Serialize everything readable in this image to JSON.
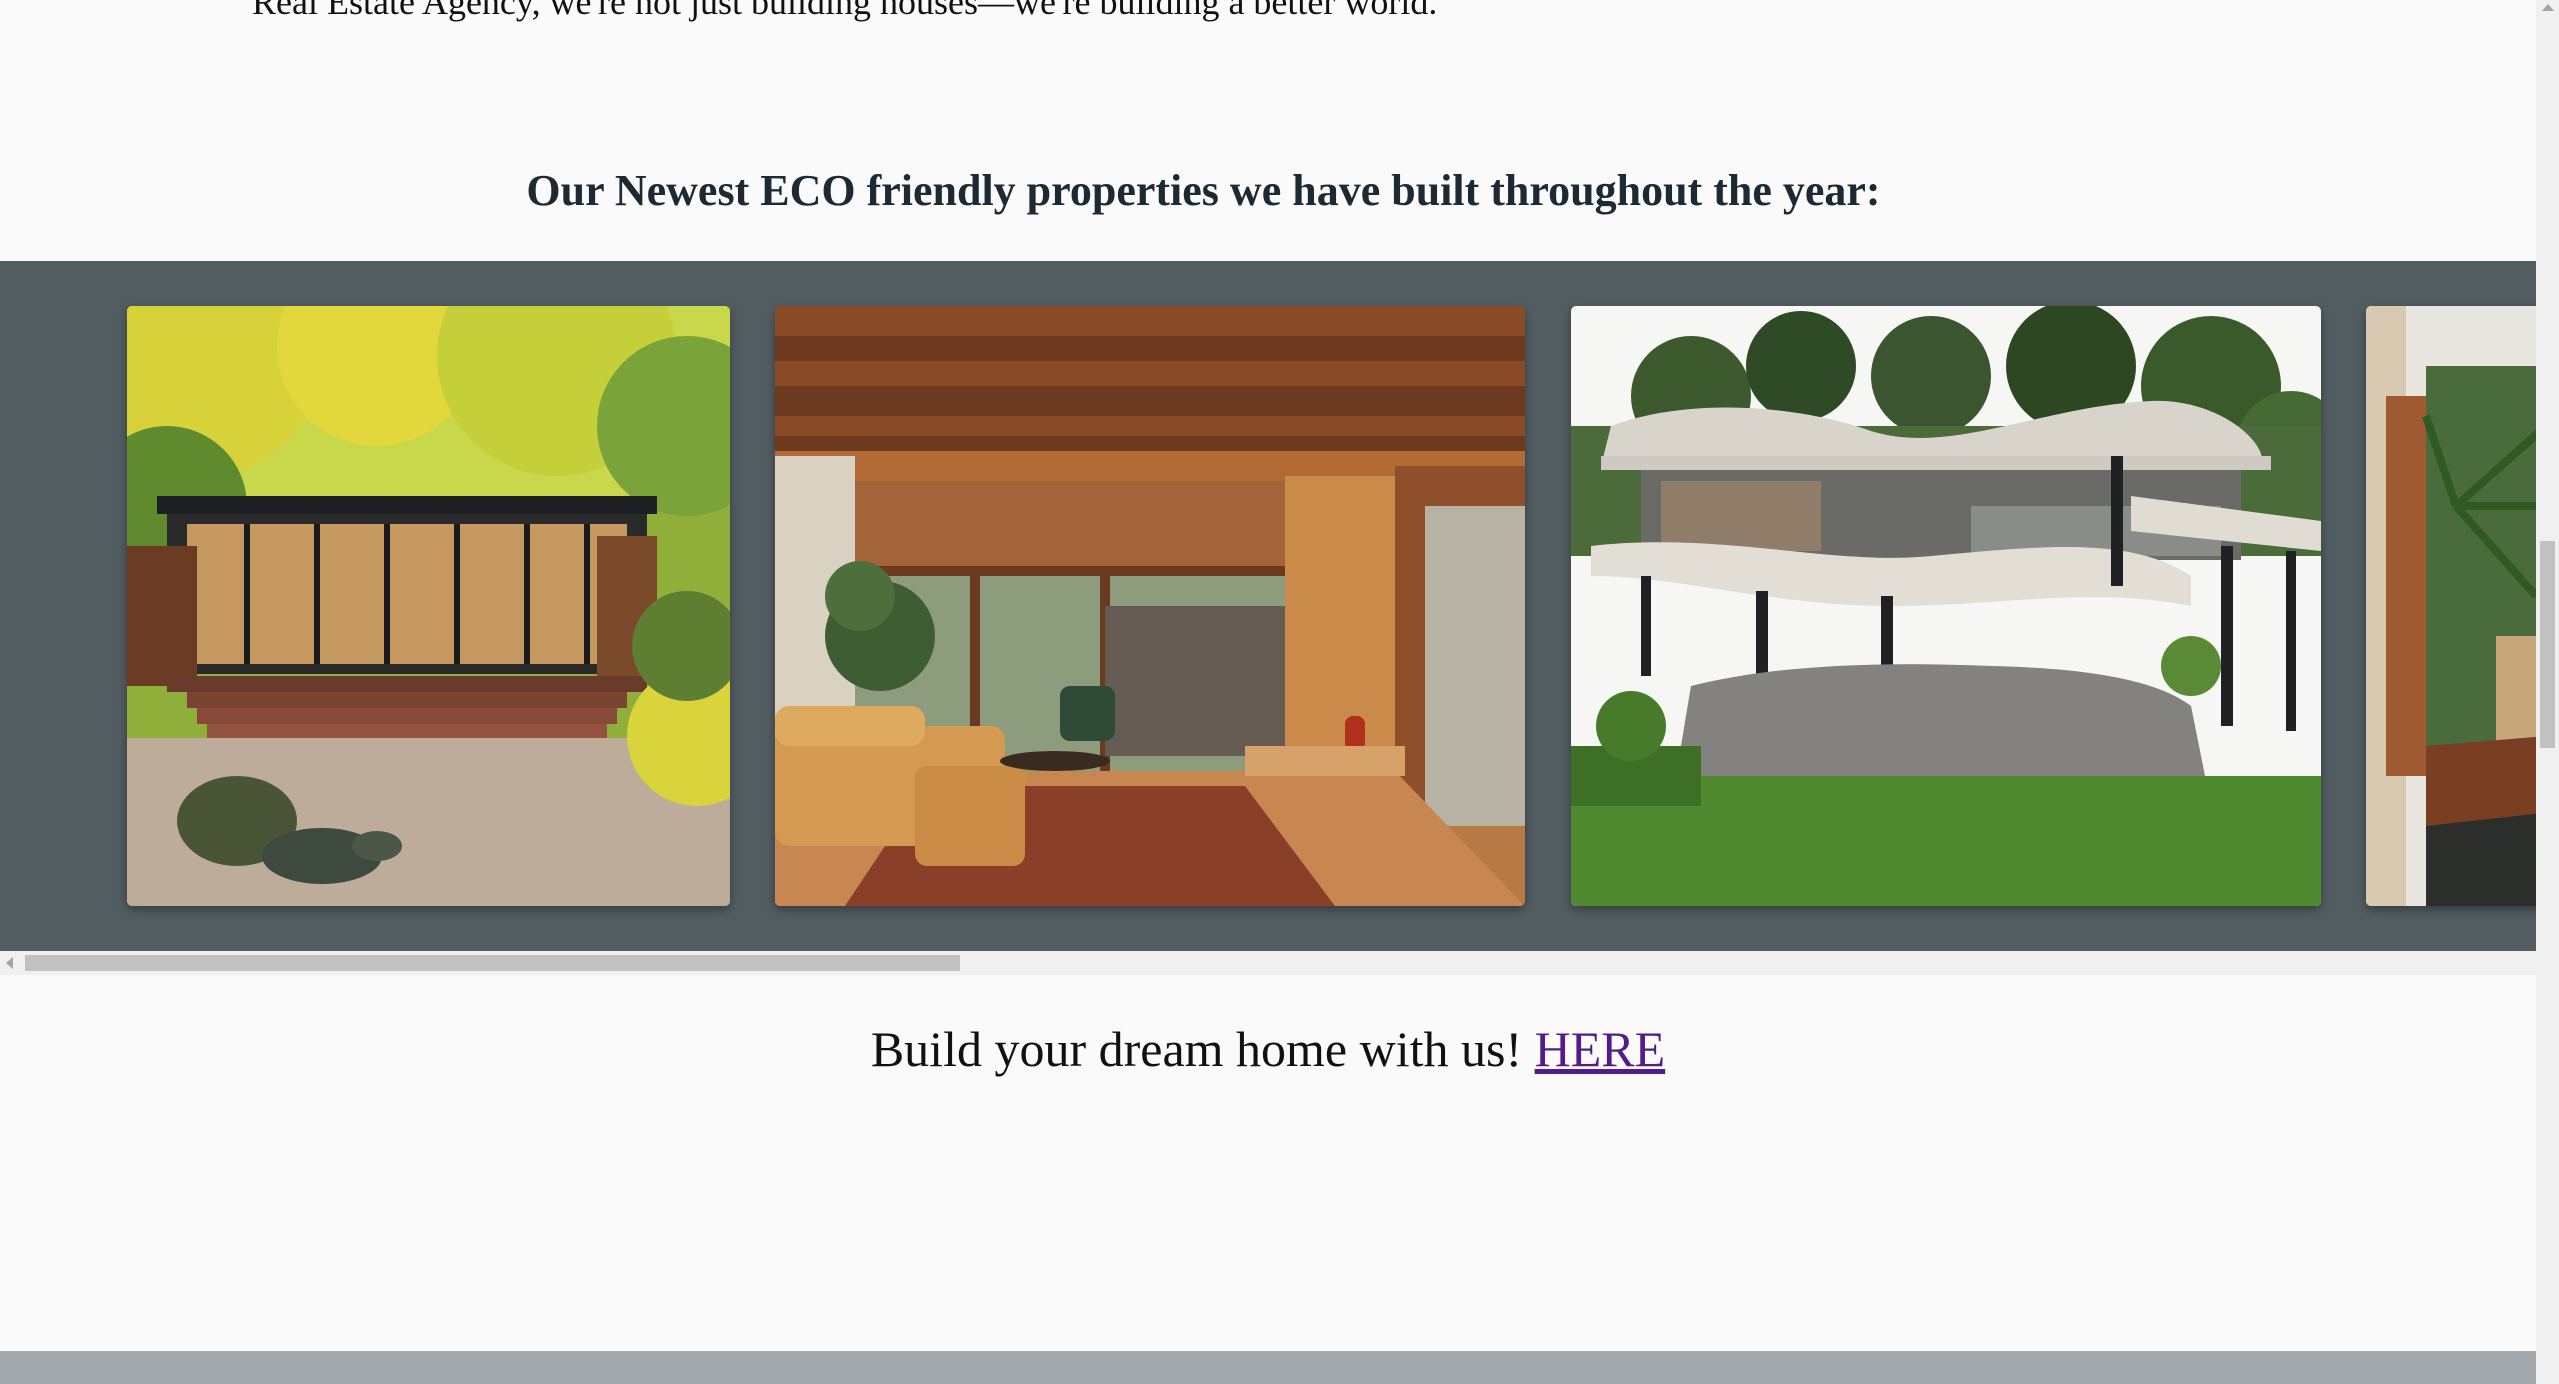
{
  "intro": {
    "text": "Real Estate Agency, we're not just building houses—we're building a better world."
  },
  "gallery": {
    "heading": "Our Newest ECO friendly properties we have built throughout the year:",
    "images": [
      {
        "subject": "glass-pavilion-garden-house",
        "alt": "Glass pavilion house in autumn garden"
      },
      {
        "subject": "wooden-interior-living-room",
        "alt": "Timber interior living room"
      },
      {
        "subject": "curved-concrete-jungle-house",
        "alt": "Curved concrete house in jungle"
      },
      {
        "subject": "tropical-interior-partial",
        "alt": "Tropical interior"
      }
    ]
  },
  "cta": {
    "text": "Build your dream home with us! ",
    "link_label": "HERE"
  },
  "colors": {
    "gallery_bg": "#525d62",
    "link": "#551a8b",
    "heading": "#1e2a33",
    "footer": "#a2a8ab"
  }
}
